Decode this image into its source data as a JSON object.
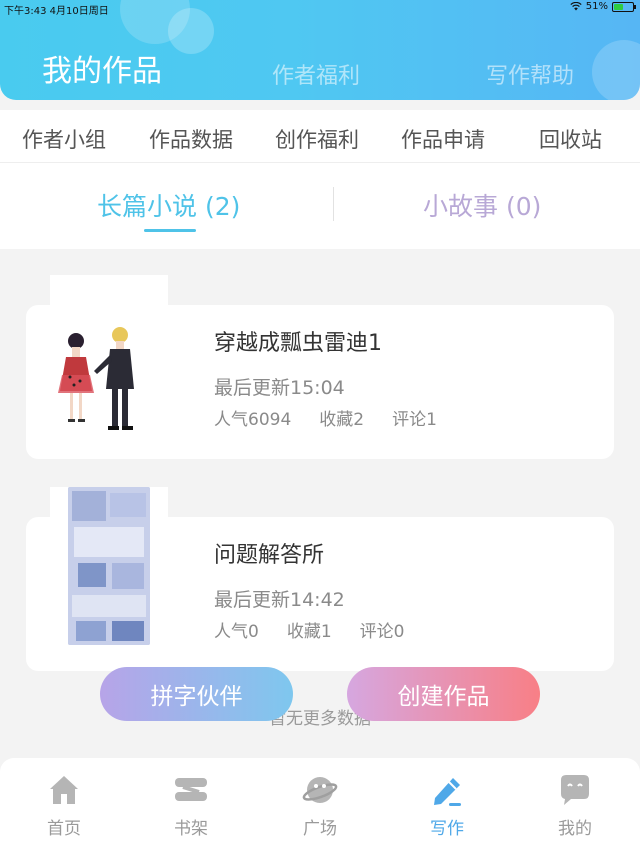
{
  "status_bar": {
    "time_date": "下午3:43   4月10日周日",
    "battery": "51%"
  },
  "header": {
    "tabs": [
      {
        "label": "我的作品",
        "active": true
      },
      {
        "label": "作者福利",
        "active": false
      },
      {
        "label": "写作帮助",
        "active": false
      }
    ]
  },
  "sub_nav": {
    "items": [
      "作者小组",
      "作品数据",
      "创作福利",
      "作品申请",
      "回收站"
    ]
  },
  "type_tabs": [
    {
      "label": "长篇小说 (2)",
      "active": true
    },
    {
      "label": "小故事 (0)",
      "active": false
    }
  ],
  "works": [
    {
      "title": "穿越成瓢虫雷迪1",
      "update": "最后更新15:04",
      "popularity": "人气6094",
      "favorites": "收藏2",
      "comments": "评论1"
    },
    {
      "title": "问题解答所",
      "update": "最后更新14:42",
      "popularity": "人气0",
      "favorites": "收藏1",
      "comments": "评论0"
    }
  ],
  "actions": {
    "left_label": "拼字伙伴",
    "right_label": "创建作品"
  },
  "list_end_text": "暂无更多数据",
  "bottom_nav": [
    {
      "label": "首页",
      "icon": "home-icon",
      "active": false
    },
    {
      "label": "书架",
      "icon": "bookshelf-icon",
      "active": false
    },
    {
      "label": "广场",
      "icon": "planet-icon",
      "active": false
    },
    {
      "label": "写作",
      "icon": "pen-icon",
      "active": true
    },
    {
      "label": "我的",
      "icon": "profile-chat-icon",
      "active": false
    }
  ],
  "colors": {
    "accent": "#4fc3e8",
    "inactive_tab": "#b8a8d6",
    "battery_fill": "#2ecc40"
  }
}
